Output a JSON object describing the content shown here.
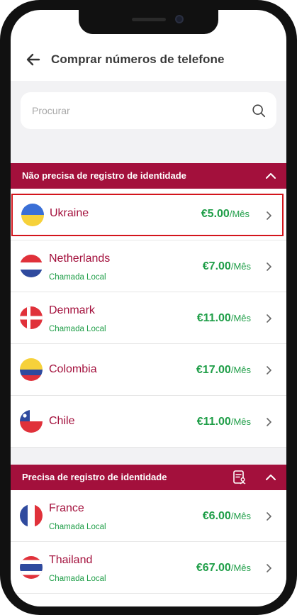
{
  "header": {
    "title": "Comprar números de telefone"
  },
  "search": {
    "placeholder": "Procurar"
  },
  "sections": [
    {
      "title": "Não precisa de registro de identidade",
      "items": [
        {
          "country": "Ukraine",
          "subtitle": "",
          "price": "€5.00",
          "unit": "/Mês",
          "selected": true
        },
        {
          "country": "Netherlands",
          "subtitle": "Chamada Local",
          "price": "€7.00",
          "unit": "/Mês"
        },
        {
          "country": "Denmark",
          "subtitle": "Chamada Local",
          "price": "€11.00",
          "unit": "/Mês"
        },
        {
          "country": "Colombia",
          "subtitle": "",
          "price": "€17.00",
          "unit": "/Mês"
        },
        {
          "country": "Chile",
          "subtitle": "",
          "price": "€11.00",
          "unit": "/Mês"
        }
      ]
    },
    {
      "title": "Precisa de registro de identidade",
      "items": [
        {
          "country": "France",
          "subtitle": "Chamada Local",
          "price": "€6.00",
          "unit": "/Mês"
        },
        {
          "country": "Thailand",
          "subtitle": "Chamada Local",
          "price": "€67.00",
          "unit": "/Mês"
        }
      ]
    }
  ],
  "colors": {
    "accent": "#a3103c",
    "price_green": "#1f9e48",
    "selection_border": "#d3151c",
    "search_bg": "#f2f2f4"
  },
  "icons": {
    "back": "arrow-left-icon",
    "search": "search-icon",
    "collapse": "chevron-up-icon",
    "identity": "id-document-icon",
    "row": "chevron-right-icon"
  }
}
